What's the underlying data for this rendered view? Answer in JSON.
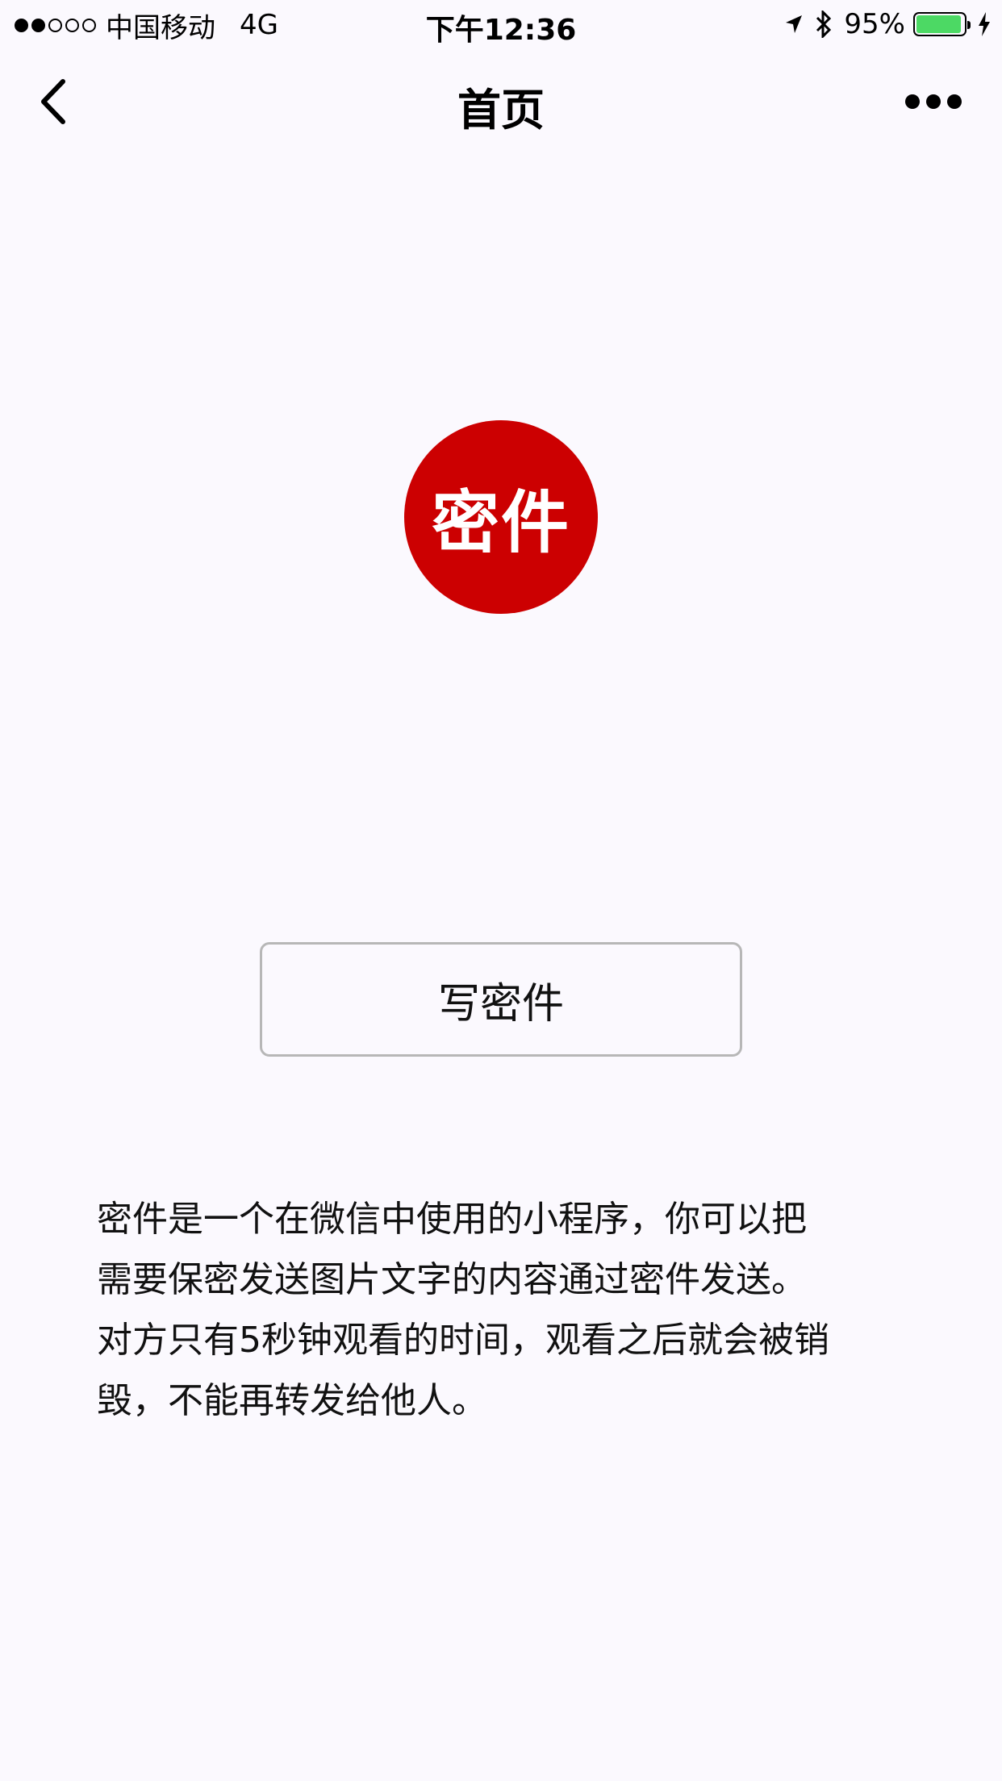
{
  "status_bar": {
    "carrier": "中国移动",
    "network": "4G",
    "time": "下午12:36",
    "battery_percent": "95%",
    "battery_level": 0.95,
    "signal_strength": 2,
    "signal_max": 5,
    "battery_color": "#4cd964"
  },
  "nav": {
    "title": "首页",
    "back_icon": "chevron-left-icon",
    "more_icon": "more-dots-icon"
  },
  "logo": {
    "text": "密件",
    "color": "#cc0001"
  },
  "actions": {
    "write_label": "写密件"
  },
  "description": {
    "lines": [
      "密件是一个在微信中使用的小程序，你可以把",
      "需要保密发送图片文字的内容通过密件发送。",
      "对方只有5秒钟观看的时间，观看之后就会被销",
      "毁，不能再转发给他人。"
    ]
  }
}
